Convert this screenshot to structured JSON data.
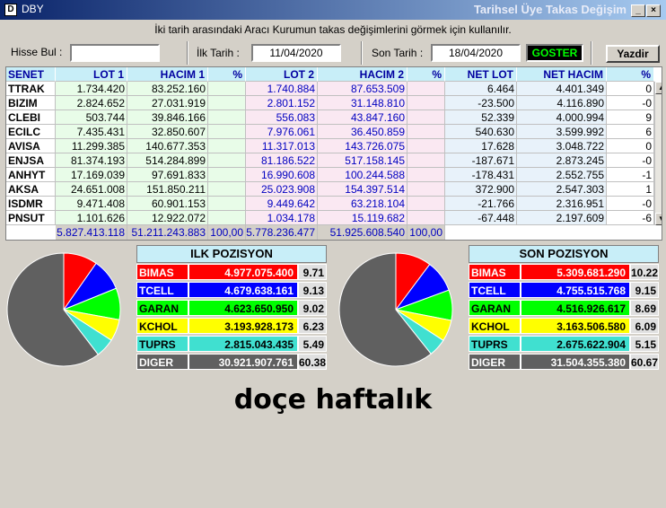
{
  "window": {
    "app_title": "DBY",
    "title": "Tarihsel Üye Takas Değişim",
    "minimize": "_",
    "maximize": "□",
    "close": "×",
    "icon": "app-icon"
  },
  "hint": "İki tarih arasındaki  Aracı Kurumun takas değişimlerini görmek için kullanılır.",
  "toolbar": {
    "hisse_label": "Hisse Bul :",
    "hisse_value": "",
    "ilk_label": "İlk Tarih :",
    "ilk_value": "11/04/2020",
    "son_label": "Son Tarih :",
    "son_value": "18/04/2020",
    "goster": "GOSTER",
    "yazdir": "Yazdir"
  },
  "table": {
    "headers": [
      "SENET",
      "LOT 1",
      "HACIM 1",
      "%",
      "LOT 2",
      "HACIM 2",
      "%",
      "NET LOT",
      "NET HACIM",
      "%"
    ],
    "rows": [
      [
        "TTRAK",
        "1.734.420",
        "83.252.160",
        "",
        "1.740.884",
        "87.653.509",
        "",
        "6.464",
        "4.401.349",
        "0"
      ],
      [
        "BIZIM",
        "2.824.652",
        "27.031.919",
        "",
        "2.801.152",
        "31.148.810",
        "",
        "-23.500",
        "4.116.890",
        "-0"
      ],
      [
        "CLEBI",
        "503.744",
        "39.846.166",
        "",
        "556.083",
        "43.847.160",
        "",
        "52.339",
        "4.000.994",
        "9"
      ],
      [
        "ECILC",
        "7.435.431",
        "32.850.607",
        "",
        "7.976.061",
        "36.450.859",
        "",
        "540.630",
        "3.599.992",
        "6"
      ],
      [
        "AVISA",
        "11.299.385",
        "140.677.353",
        "",
        "11.317.013",
        "143.726.075",
        "",
        "17.628",
        "3.048.722",
        "0"
      ],
      [
        "ENJSA",
        "81.374.193",
        "514.284.899",
        "",
        "81.186.522",
        "517.158.145",
        "",
        "-187.671",
        "2.873.245",
        "-0"
      ],
      [
        "ANHYT",
        "17.169.039",
        "97.691.833",
        "",
        "16.990.608",
        "100.244.588",
        "",
        "-178.431",
        "2.552.755",
        "-1"
      ],
      [
        "AKSA",
        "24.651.008",
        "151.850.211",
        "",
        "25.023.908",
        "154.397.514",
        "",
        "372.900",
        "2.547.303",
        "1"
      ],
      [
        "ISDMR",
        "9.471.408",
        "60.901.153",
        "",
        "9.449.642",
        "63.218.104",
        "",
        "-21.766",
        "2.316.951",
        "-0"
      ],
      [
        "PNSUT",
        "1.101.626",
        "12.922.072",
        "",
        "1.034.178",
        "15.119.682",
        "",
        "-67.448",
        "2.197.609",
        "-6"
      ]
    ],
    "totals": [
      "",
      "5.827.413.118",
      "51.211.243.883",
      "100,00",
      "5.778.236.477",
      "51.925.608.540",
      "100,00",
      "",
      "",
      ""
    ],
    "scroll_up": "▲",
    "scroll_down": "▼"
  },
  "ilk": {
    "title": "ILK POZISYON",
    "rows": [
      {
        "name": "BIMAS",
        "value": "4.977.075.400",
        "pct": "9.71",
        "bg": "#ff0000",
        "fg": "#ffffff"
      },
      {
        "name": "TCELL",
        "value": "4.679.638.161",
        "pct": "9.13",
        "bg": "#0000ff",
        "fg": "#ffffff"
      },
      {
        "name": "GARAN",
        "value": "4.623.650.950",
        "pct": "9.02",
        "bg": "#00ff00",
        "fg": "#000000"
      },
      {
        "name": "KCHOL",
        "value": "3.193.928.173",
        "pct": "6.23",
        "bg": "#ffff00",
        "fg": "#000000"
      },
      {
        "name": "TUPRS",
        "value": "2.815.043.435",
        "pct": "5.49",
        "bg": "#40e0d0",
        "fg": "#000000"
      },
      {
        "name": "DIGER",
        "value": "30.921.907.761",
        "pct": "60.38",
        "bg": "#606060",
        "fg": "#ffffff"
      }
    ]
  },
  "son": {
    "title": "SON POZISYON",
    "rows": [
      {
        "name": "BIMAS",
        "value": "5.309.681.290",
        "pct": "10.22",
        "bg": "#ff0000",
        "fg": "#ffffff"
      },
      {
        "name": "TCELL",
        "value": "4.755.515.768",
        "pct": "9.15",
        "bg": "#0000ff",
        "fg": "#ffffff"
      },
      {
        "name": "GARAN",
        "value": "4.516.926.617",
        "pct": "8.69",
        "bg": "#00ff00",
        "fg": "#000000"
      },
      {
        "name": "KCHOL",
        "value": "3.163.506.580",
        "pct": "6.09",
        "bg": "#ffff00",
        "fg": "#000000"
      },
      {
        "name": "TUPRS",
        "value": "2.675.622.904",
        "pct": "5.15",
        "bg": "#40e0d0",
        "fg": "#000000"
      },
      {
        "name": "DIGER",
        "value": "31.504.355.380",
        "pct": "60.67",
        "bg": "#606060",
        "fg": "#ffffff"
      }
    ]
  },
  "caption": "doçe haftalık"
}
